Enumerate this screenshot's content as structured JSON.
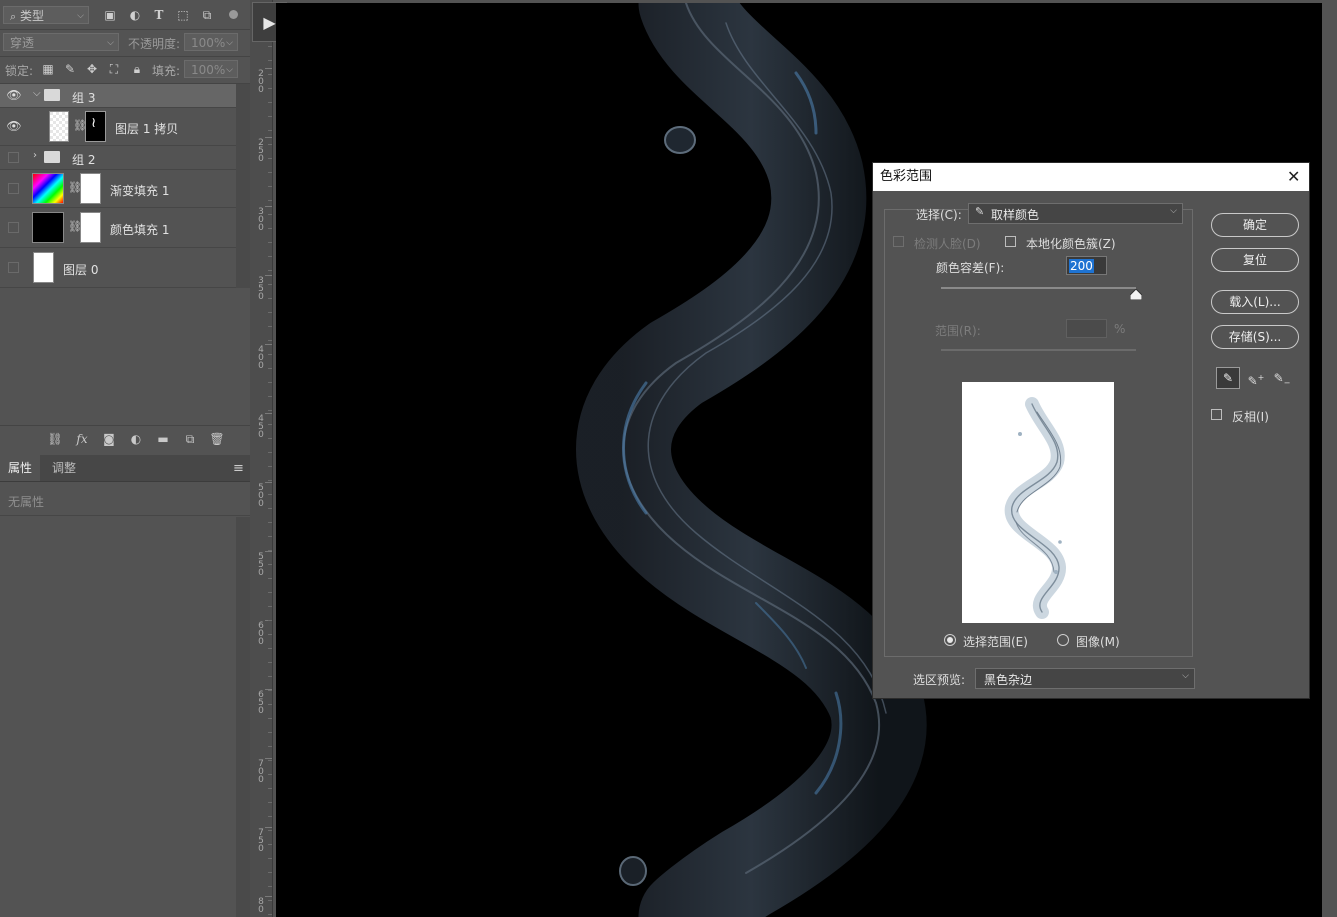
{
  "layers_panel": {
    "kind_label": "类型",
    "blend_mode": "穿透",
    "opacity_label": "不透明度:",
    "opacity_value": "100%",
    "lock_label": "锁定:",
    "fill_label": "填充:",
    "fill_value": "100%",
    "layers": [
      {
        "name": "组 3",
        "type": "group",
        "visible": true,
        "expanded": true
      },
      {
        "name": "图层 1 拷贝",
        "type": "layer-with-mask",
        "visible": true
      },
      {
        "name": "组 2",
        "type": "group",
        "visible": false,
        "expanded": false
      },
      {
        "name": "渐变填充 1",
        "type": "gradient-fill",
        "visible": false
      },
      {
        "name": "颜色填充 1",
        "type": "color-fill",
        "visible": false
      },
      {
        "name": "图层 0",
        "type": "layer",
        "visible": false
      }
    ]
  },
  "properties_panel": {
    "tabs": [
      "属性",
      "调整"
    ],
    "active_tab": "属性",
    "empty_text": "无属性"
  },
  "ruler": {
    "labels": [
      "2\n0\n0",
      "2\n5\n0",
      "3\n0\n0",
      "3\n5\n0",
      "4\n0\n0",
      "4\n5\n0",
      "5\n0\n0",
      "5\n5\n0",
      "6\n0\n0",
      "6\n5\n0",
      "7\n0\n0",
      "7\n5\n0",
      "8\n0"
    ]
  },
  "dialog": {
    "title": "色彩范围",
    "select_label": "选择(C):",
    "select_value": "取样颜色",
    "detect_faces_label": "检测人脸(D)",
    "localized_label": "本地化颜色簇(Z)",
    "fuzziness_label": "颜色容差(F):",
    "fuzziness_value": "200",
    "fuzziness_fraction": 1.0,
    "range_label": "范围(R):",
    "range_unit": "%",
    "radio_selection_label": "选择范围(E)",
    "radio_image_label": "图像(M)",
    "radio_selected": "selection",
    "preview_label": "选区预览:",
    "preview_value": "黑色杂边",
    "buttons": {
      "ok": "确定",
      "reset": "复位",
      "load": "载入(L)...",
      "save": "存储(S)..."
    },
    "invert_label": "反相(I)"
  },
  "colors": {
    "panel_bg": "#535353",
    "canvas_bg": "#000000",
    "selection_highlight": "#1e73d2"
  }
}
